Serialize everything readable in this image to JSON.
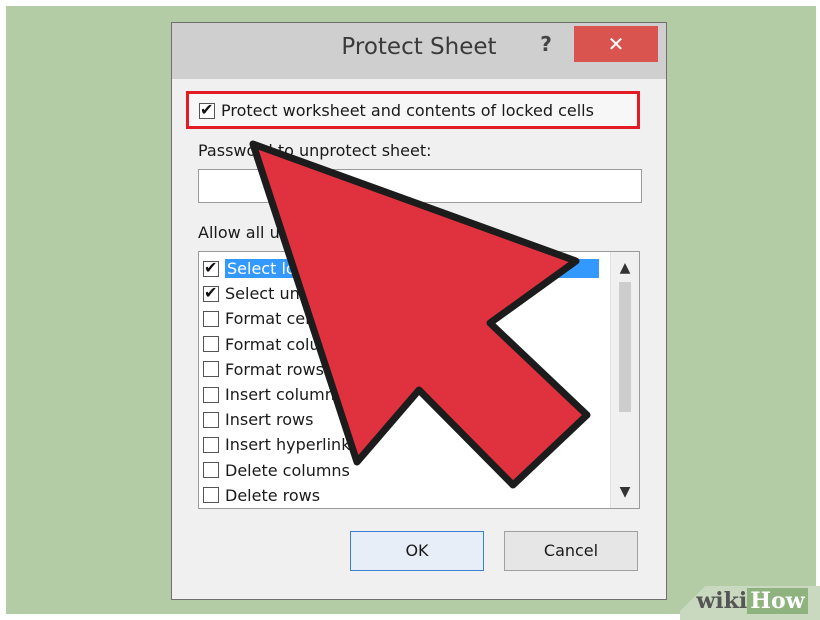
{
  "dialog": {
    "title": "Protect Sheet",
    "help_label": "?",
    "close_label": "✕"
  },
  "protect_option": {
    "label": "Protect worksheet and contents of locked cells",
    "checked": true
  },
  "password": {
    "label": "Password to unprotect sheet:",
    "value": ""
  },
  "allow": {
    "label": "Allow all users of this worksheet to:",
    "items": [
      {
        "label": "Select locked cells",
        "checked": true,
        "selected": true
      },
      {
        "label": "Select unlocked cells",
        "checked": true,
        "selected": false
      },
      {
        "label": "Format cells",
        "checked": false,
        "selected": false
      },
      {
        "label": "Format columns",
        "checked": false,
        "selected": false
      },
      {
        "label": "Format rows",
        "checked": false,
        "selected": false
      },
      {
        "label": "Insert columns",
        "checked": false,
        "selected": false
      },
      {
        "label": "Insert rows",
        "checked": false,
        "selected": false
      },
      {
        "label": "Insert hyperlinks",
        "checked": false,
        "selected": false
      },
      {
        "label": "Delete columns",
        "checked": false,
        "selected": false
      },
      {
        "label": "Delete rows",
        "checked": false,
        "selected": false
      }
    ]
  },
  "buttons": {
    "ok": "OK",
    "cancel": "Cancel"
  },
  "watermark": {
    "wiki": "wiki",
    "how": "How"
  },
  "colors": {
    "highlight_border": "#e31b24",
    "arrow_fill": "#e0323e",
    "selection": "#3399ff",
    "background": "#b4cca5"
  }
}
